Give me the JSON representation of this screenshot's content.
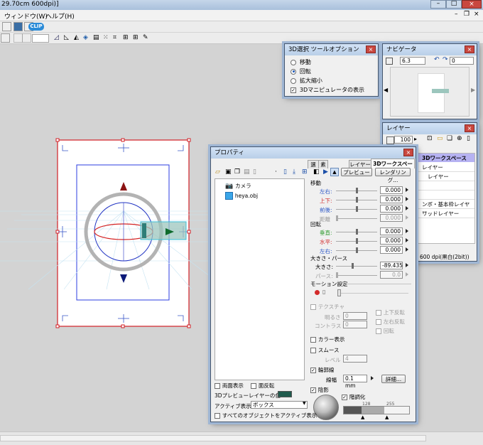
{
  "titlebar": {
    "title": "29.70cm 600dpi)]"
  },
  "menubar": {
    "items": [
      "ウィンドウ(W)",
      "ヘルプ(H)"
    ]
  },
  "toolbar": {
    "badge": "CLIP"
  },
  "tool_options": {
    "title": "3D選択 ツールオプション",
    "options": [
      {
        "label": "移動",
        "selected": false
      },
      {
        "label": "回転",
        "selected": true
      },
      {
        "label": "拡大縮小",
        "selected": false
      }
    ],
    "manipulator": {
      "label": "3Dマニピュレータの表示",
      "checked": true
    }
  },
  "navigator": {
    "title": "ナビゲータ",
    "zoom": "6.3",
    "rotation": "0"
  },
  "layer_panel": {
    "title": "レイヤー",
    "opacity": "100 %",
    "layers": [
      {
        "name": "3Dワークスペース",
        "selected": true
      },
      {
        "name": "レイヤー"
      },
      {
        "name": "レイヤー"
      },
      {
        "name": ""
      },
      {
        "name": ""
      },
      {
        "name": "ンボ・基本枠レイヤー"
      },
      {
        "name": "リッドレイヤー"
      }
    ],
    "status": "600 dpi(黒白(2bit))"
  },
  "properties": {
    "title": "プロパティ",
    "tabs": [
      "選",
      "素",
      "レイヤー",
      "3Dワークスペース"
    ],
    "preview_btn": "プレビュー",
    "render_btn": "レンダリング...",
    "tree": [
      {
        "label": "カメラ",
        "icon": "camera-icon"
      },
      {
        "label": "heya.obj",
        "icon": "cube-icon"
      }
    ],
    "move": {
      "section": "移動",
      "rows": [
        {
          "label": "左右:",
          "value": "0.000",
          "color": "blue"
        },
        {
          "label": "上下:",
          "value": "0.000",
          "color": "red"
        },
        {
          "label": "前後:",
          "value": "0.000",
          "color": "blue"
        },
        {
          "label": "距離",
          "value": "0.000",
          "color": "gray"
        }
      ]
    },
    "rotate": {
      "section": "回転",
      "rows": [
        {
          "label": "垂直:",
          "value": "0.000",
          "color": "green"
        },
        {
          "label": "水平:",
          "value": "0.000",
          "color": "red"
        },
        {
          "label": "左右:",
          "value": "0.000",
          "color": "blue"
        }
      ]
    },
    "size": {
      "section": "大きさ・パース",
      "rows": [
        {
          "label": "大きさ:",
          "value": "-89.435",
          "color": "black"
        },
        {
          "label": "パース:",
          "value": "0.0",
          "color": "gray"
        }
      ]
    },
    "motion_section": "モーション設定",
    "texture": {
      "label": "テクスチャ",
      "checked": false
    },
    "brightness": {
      "label": "明るさ",
      "value": "0"
    },
    "contrast": {
      "label": "コントラスト",
      "value": "0"
    },
    "flip_v": "上下反転",
    "flip_h": "左右反転",
    "rotate_lbl": "回転",
    "color_display": {
      "label": "カラー表示",
      "checked": false
    },
    "smooth": {
      "label": "スムース",
      "checked": false
    },
    "level": {
      "label": "レベル",
      "value": "4"
    },
    "outline": {
      "label": "輪郭線",
      "checked": true
    },
    "line_width": {
      "label": "線幅",
      "value": "0.1 mm"
    },
    "detail_btn": "詳細...",
    "shadow": {
      "label": "陰影",
      "checked": true
    },
    "posterize": {
      "label": "階調化",
      "checked": true
    },
    "ramp_values": [
      "128",
      "255"
    ],
    "double_sided": {
      "label": "両面表示",
      "checked": false
    },
    "invert_face": {
      "label": "面反転",
      "checked": false
    },
    "preview_color_label": "3Dプレビューレイヤーの色:",
    "preview_color": "#1f5a4c",
    "active_label": "アクティブ表示:",
    "active_value": "ボックス",
    "all_active": {
      "label": "すべてのオブジェクトをアクティブ表示",
      "checked": false
    }
  },
  "colors": {
    "frame_red": "#d11f26",
    "window_border": "#45566e",
    "selected_layer": "#b6b2f2"
  }
}
